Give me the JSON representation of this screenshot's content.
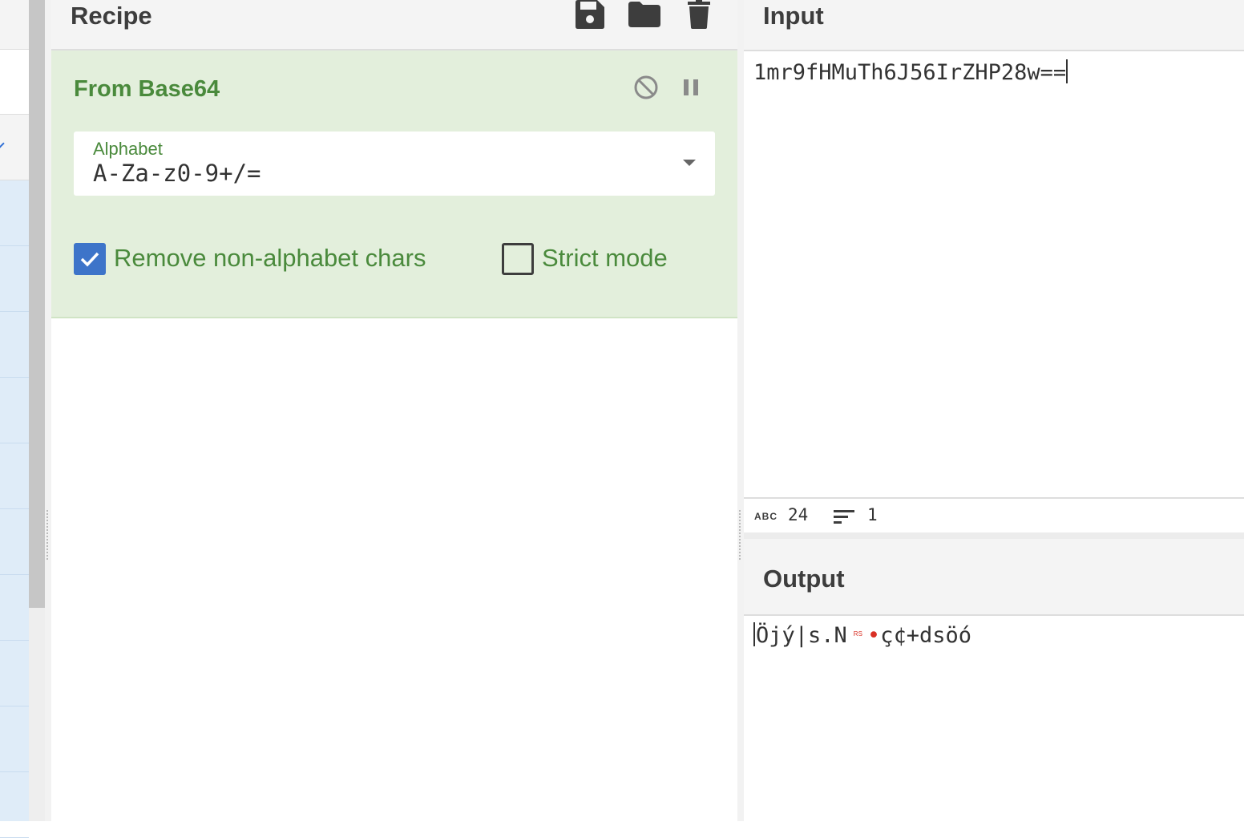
{
  "recipe": {
    "title": "Recipe",
    "icons": [
      "save-icon",
      "folder-icon",
      "trash-icon"
    ],
    "operation": {
      "name": "From Base64",
      "controls": [
        "disable-icon",
        "pause-icon"
      ],
      "alphabet_label": "Alphabet",
      "alphabet_value": "A-Za-z0-9+/=",
      "remove_non_alphabet_label": "Remove non-alphabet chars",
      "remove_non_alphabet_checked": true,
      "strict_mode_label": "Strict mode",
      "strict_mode_checked": false
    }
  },
  "input": {
    "title": "Input",
    "text": "1mr9fHMuTh6J56IrZHP28w==",
    "status": {
      "length_badge": "ABC",
      "length": "24",
      "lines": "1"
    }
  },
  "output": {
    "title": "Output",
    "text_start": "Öjý|s.N",
    "control_char": "RS",
    "dot_char": "•",
    "text_end": "ç¢+dsöó"
  },
  "colors": {
    "accent_green": "#4a8a3c",
    "operation_bg": "#e3efdc",
    "checkbox_blue": "#3d74c9",
    "control_char_red": "#d93025"
  }
}
